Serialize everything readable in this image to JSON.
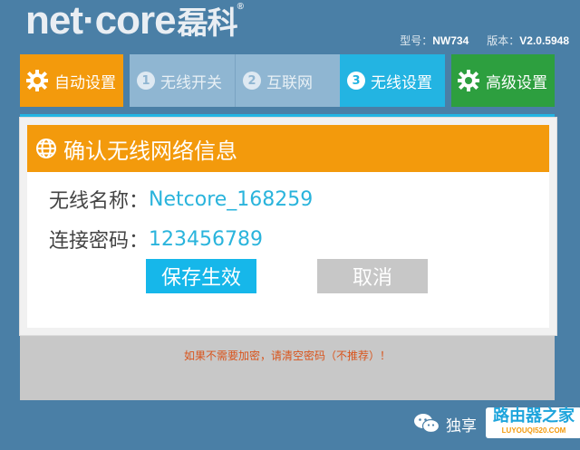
{
  "header": {
    "logo_text": "net·core",
    "logo_cn": "磊科",
    "logo_mark": "®",
    "model_label": "型号：",
    "model_value": "NW734",
    "version_label": "版本：",
    "version_value": "V2.0.5948"
  },
  "nav": {
    "auto_label": "自动设置",
    "step1_num": "1",
    "step1_label": "无线开关",
    "step2_num": "2",
    "step2_label": "互联网",
    "step3_num": "3",
    "step3_label": "无线设置",
    "advanced_label": "高级设置"
  },
  "dialog": {
    "title": "确认无线网络信息",
    "ssid_label": "无线名称：",
    "ssid_value": "Netcore_168259",
    "password_label": "连接密码：",
    "password_value": "123456789",
    "save_label": "保存生效",
    "cancel_label": "取消"
  },
  "panel": {
    "warning": "如果不需要加密，请清空密码（不推荐）！"
  },
  "watermark": {
    "text": "独享",
    "brand_cn": "路由器之家",
    "brand_en": "LUYOUQI520.COM"
  },
  "colors": {
    "background": "#4a7fa6",
    "orange": "#f39a0c",
    "cyan": "#23b4e2",
    "green": "#2d9f3f"
  },
  "icons": {
    "auto": "gear-icon",
    "advanced": "gear-icon",
    "dialog": "globe-icon",
    "watermark": "wechat-icon"
  }
}
